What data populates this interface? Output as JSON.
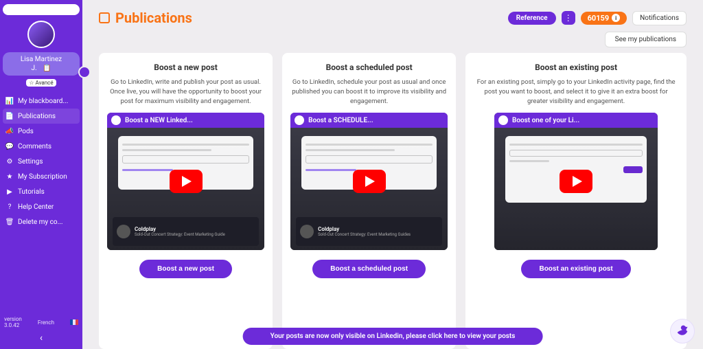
{
  "sidebar": {
    "user_first": "Lisa",
    "user_last": "Martinez",
    "user_initial": "J.",
    "rank": "☆ Avancé",
    "items": [
      {
        "icon": "📊",
        "label": "My blackboard..."
      },
      {
        "icon": "📄",
        "label": "Publications"
      },
      {
        "icon": "📣",
        "label": "Pods"
      },
      {
        "icon": "💬",
        "label": "Comments"
      },
      {
        "icon": "⚙",
        "label": "Settings"
      },
      {
        "icon": "★",
        "label": "My Subscription"
      },
      {
        "icon": "▶",
        "label": "Tutorials"
      },
      {
        "icon": "?",
        "label": "Help Center"
      },
      {
        "icon": "🗑",
        "label": "Delete my co..."
      }
    ],
    "version_label": "version",
    "version": "3.0.42",
    "lang": "French",
    "collapse": "‹"
  },
  "header": {
    "title": "Publications",
    "reference": "Reference",
    "coins": "60159",
    "coin_i": "i",
    "notifications": "Notifications",
    "see_publications": "See my publications"
  },
  "cards": [
    {
      "title": "Boost a new post",
      "desc": "Go to LinkedIn, write and publish your post as usual. Once live, you will have the opportunity to boost your post for maximum visibility and engagement.",
      "video_title": "Boost a NEW Linked...",
      "feed_title": "Coldplay",
      "feed_sub": "Sold-Out Concert Strategy: Event Marketing Guide",
      "button": "Boost a new post"
    },
    {
      "title": "Boost a scheduled post",
      "desc": "Go to LinkedIn, schedule your post as usual and once published you can boost it to improve its visibility and engagement.",
      "video_title": "Boost a SCHEDULE...",
      "feed_title": "Coldplay",
      "feed_sub": "Sold-Out Concert Strategy: Event Marketing Guides",
      "button": "Boost a scheduled post"
    },
    {
      "title": "Boost an existing post",
      "desc": "For an existing post, simply go to your LinkedIn activity page, find the post you want to boost, and select it to give it an extra boost for greater visibility and engagement.",
      "video_title": "Boost one of your Li...",
      "feed_title": "",
      "feed_sub": "",
      "button": "Boost an existing post"
    }
  ],
  "banner": "Your posts are now only visible on Linkedin, please click here to view your posts"
}
